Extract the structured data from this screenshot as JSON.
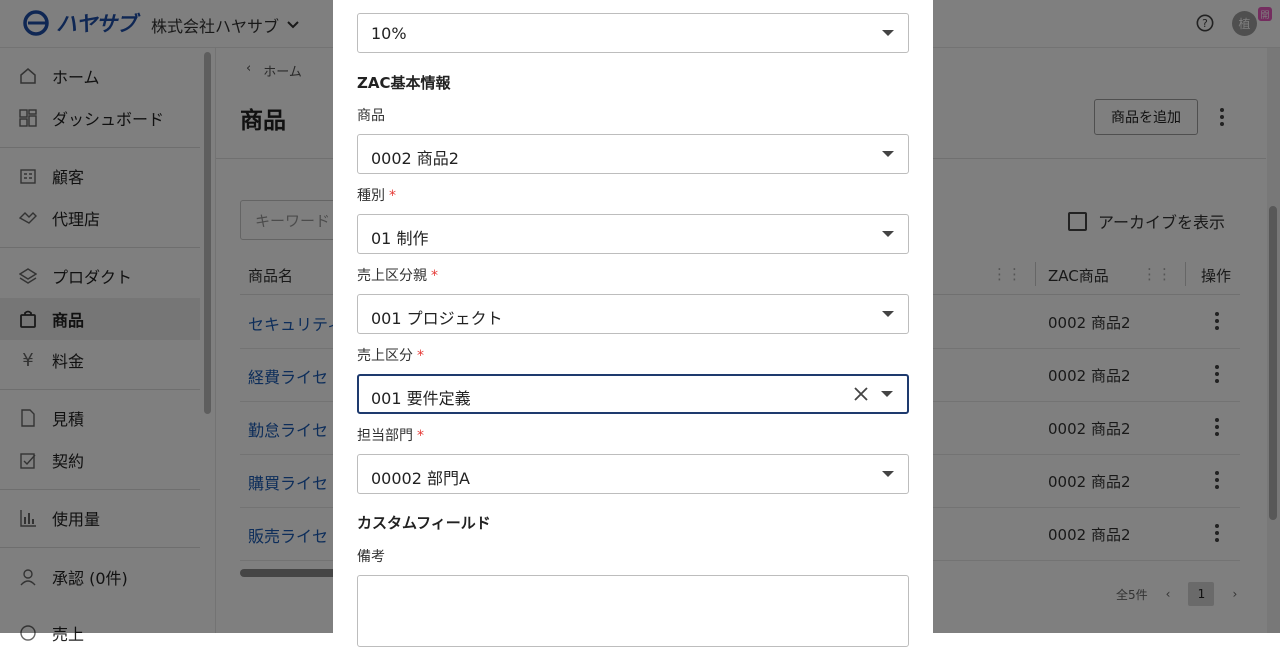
{
  "topbar": {
    "logo_text": "ハヤサブ",
    "company": "株式会社ハヤサブ",
    "avatar_initial": "植",
    "avatar_badge": "開"
  },
  "sidebar": {
    "items": [
      {
        "label": "ホーム",
        "icon": "home-icon"
      },
      {
        "label": "ダッシュボード",
        "icon": "dashboard-icon"
      },
      {
        "label": "顧客",
        "icon": "building-icon"
      },
      {
        "label": "代理店",
        "icon": "handshake-icon"
      },
      {
        "label": "プロダクト",
        "icon": "layers-icon"
      },
      {
        "label": "商品",
        "icon": "bag-icon"
      },
      {
        "label": "料金",
        "icon": "yen-icon"
      },
      {
        "label": "見積",
        "icon": "document-icon"
      },
      {
        "label": "契約",
        "icon": "contract-icon"
      },
      {
        "label": "使用量",
        "icon": "bar-chart-icon"
      },
      {
        "label": "承認 (0件)",
        "icon": "person-icon"
      },
      {
        "label": "売上",
        "icon": "sales-icon"
      }
    ]
  },
  "main": {
    "breadcrumb": "ホーム",
    "title": "商品",
    "add_button": "商品を追加",
    "search_placeholder": "キーワード",
    "archive_label": "アーカイブを表示",
    "columns": {
      "name": "商品名",
      "zac": "ZAC商品",
      "ops": "操作"
    },
    "rows": [
      {
        "name": "セキュリティ",
        "zac": "0002 商品2"
      },
      {
        "name": "経費ライセ",
        "zac": "0002 商品2"
      },
      {
        "name": "勤怠ライセ",
        "zac": "0002 商品2"
      },
      {
        "name": "購買ライセ",
        "zac": "0002 商品2"
      },
      {
        "name": "販売ライセ",
        "zac": "0002 商品2"
      }
    ],
    "pager_total": "全5件",
    "pager_current": "1"
  },
  "dialog": {
    "tax_rate": "10%",
    "zac_section": "ZAC基本情報",
    "product_label": "商品",
    "product_value": "0002 商品2",
    "type_label": "種別",
    "type_value": "01 制作",
    "sales_parent_label": "売上区分親",
    "sales_parent_value": "001 プロジェクト",
    "sales_class_label": "売上区分",
    "sales_class_value": "001 要件定義",
    "dept_label": "担当部門",
    "dept_value": "00002 部門A",
    "custom_section": "カスタムフィールド",
    "notes_label": "備考",
    "required_mark": "*"
  }
}
